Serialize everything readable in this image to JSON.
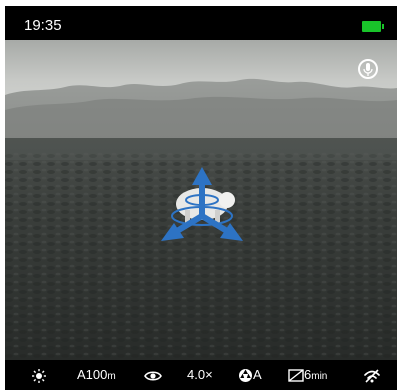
{
  "status_bar": {
    "time": "19:35",
    "battery_color": "#19c42a",
    "battery_icon": "battery-full-icon"
  },
  "viewport": {
    "scene": "thermal-field-view",
    "mic_icon": "microphone-icon",
    "overlay_icon": "move-arrows-icon",
    "overlay_color": "#2d73c4"
  },
  "bottom_bar": {
    "brightness_icon": "brightness-icon",
    "range_value": "A100",
    "range_unit": "m",
    "eye_icon": "eye-icon",
    "zoom": "4.0×",
    "calibration_icon": "calibration-icon",
    "calibration_mode": "A",
    "sleep_icon": "display-off-icon",
    "sleep_value": "6",
    "sleep_unit": "min",
    "wifi_icon": "wifi-off-icon"
  }
}
